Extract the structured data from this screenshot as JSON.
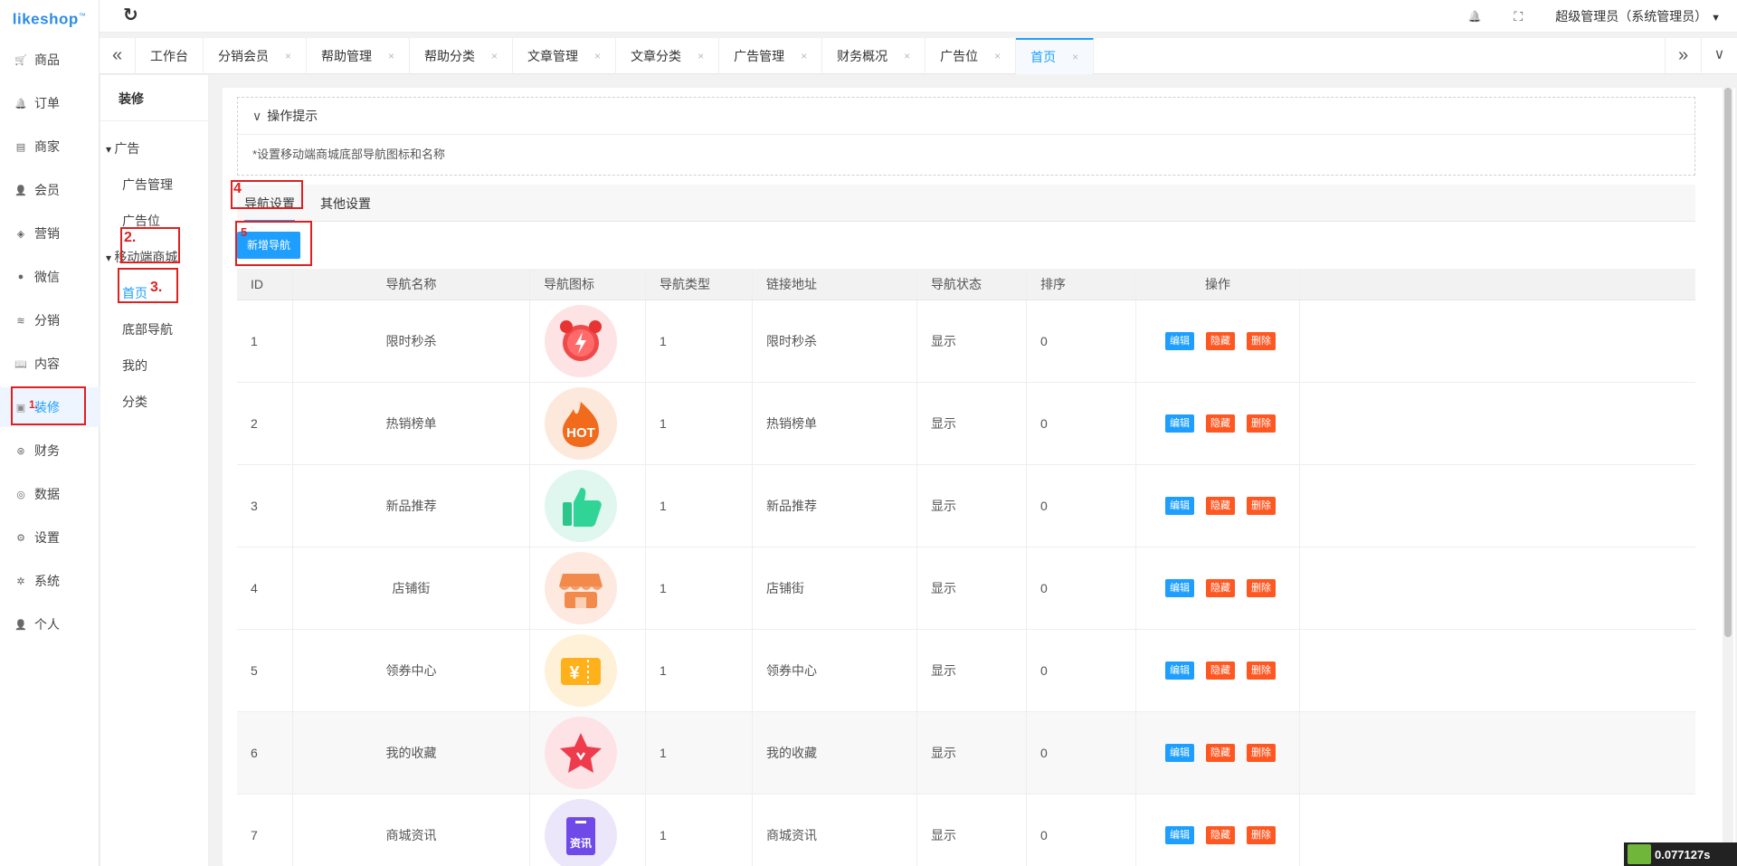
{
  "app": {
    "logo": "likeshop",
    "logo_tm": "™"
  },
  "sidebar": {
    "items": [
      {
        "label": "商品",
        "icon": "cart-icon",
        "glyph": "🛒"
      },
      {
        "label": "订单",
        "icon": "bell-icon",
        "glyph": "🔔"
      },
      {
        "label": "商家",
        "icon": "shop-icon",
        "glyph": "▤"
      },
      {
        "label": "会员",
        "icon": "user-icon",
        "glyph": "👤"
      },
      {
        "label": "营销",
        "icon": "gift-icon",
        "glyph": "◈"
      },
      {
        "label": "微信",
        "icon": "wechat-icon",
        "glyph": "●"
      },
      {
        "label": "分销",
        "icon": "layers-icon",
        "glyph": "≋"
      },
      {
        "label": "内容",
        "icon": "book-icon",
        "glyph": "📖"
      },
      {
        "label": "装修",
        "icon": "decorate-icon",
        "glyph": "▣"
      },
      {
        "label": "财务",
        "icon": "yen-icon",
        "glyph": "⊛"
      },
      {
        "label": "数据",
        "icon": "globe-icon",
        "glyph": "◎"
      },
      {
        "label": "设置",
        "icon": "settings-icon",
        "glyph": "⚙"
      },
      {
        "label": "系统",
        "icon": "system-icon",
        "glyph": "✲"
      },
      {
        "label": "个人",
        "icon": "person-icon",
        "glyph": "👤"
      }
    ]
  },
  "header": {
    "refresh": "↻",
    "bell": "🔔",
    "fullscreen": "⛶",
    "user": "超级管理员（系统管理员）",
    "caret": "▼"
  },
  "tabs": {
    "prev": "«",
    "next": "»",
    "menu": "∨",
    "close": "×",
    "items": [
      {
        "label": "工作台"
      },
      {
        "label": "分销会员"
      },
      {
        "label": "帮助管理"
      },
      {
        "label": "帮助分类"
      },
      {
        "label": "文章管理"
      },
      {
        "label": "文章分类"
      },
      {
        "label": "广告管理"
      },
      {
        "label": "财务概况"
      },
      {
        "label": "广告位"
      },
      {
        "label": "首页"
      }
    ]
  },
  "subside": {
    "title": "装修",
    "items": [
      {
        "label": "广告",
        "group": true
      },
      {
        "label": "广告管理"
      },
      {
        "label": "广告位"
      },
      {
        "label": "移动端商城",
        "group": true
      },
      {
        "label": "首页",
        "active": true
      },
      {
        "label": "底部导航"
      },
      {
        "label": "我的"
      },
      {
        "label": "分类"
      }
    ]
  },
  "tips": {
    "header": "操作提示",
    "text": "*设置移动端商城底部导航图标和名称"
  },
  "content_tabs": [
    "导航设置",
    "其他设置"
  ],
  "add_button": "新增导航",
  "table": {
    "headers": [
      "ID",
      "导航名称",
      "导航图标",
      "导航类型",
      "链接地址",
      "导航状态",
      "排序",
      "操作"
    ],
    "rows": [
      {
        "id": "1",
        "name": "限时秒杀",
        "icon": "alarm-clock-icon",
        "type": "1",
        "link": "限时秒杀",
        "state": "显示",
        "sort": "0"
      },
      {
        "id": "2",
        "name": "热销榜单",
        "icon": "hot-flame-icon",
        "type": "1",
        "link": "热销榜单",
        "state": "显示",
        "sort": "0"
      },
      {
        "id": "3",
        "name": "新品推荐",
        "icon": "thumbs-up-icon",
        "type": "1",
        "link": "新品推荐",
        "state": "显示",
        "sort": "0"
      },
      {
        "id": "4",
        "name": "店铺街",
        "icon": "store-icon",
        "type": "1",
        "link": "店铺街",
        "state": "显示",
        "sort": "0"
      },
      {
        "id": "5",
        "name": "领券中心",
        "icon": "coupon-icon",
        "type": "1",
        "link": "领券中心",
        "state": "显示",
        "sort": "0"
      },
      {
        "id": "6",
        "name": "我的收藏",
        "icon": "star-icon",
        "type": "1",
        "link": "我的收藏",
        "state": "显示",
        "sort": "0"
      },
      {
        "id": "7",
        "name": "商城资讯",
        "icon": "news-icon",
        "type": "1",
        "link": "商城资讯",
        "state": "显示",
        "sort": "0"
      }
    ],
    "actions": {
      "edit": "编辑",
      "hide": "隐藏",
      "delete": "删除"
    },
    "hot_text": "HOT",
    "yen": "¥",
    "news_text": "资讯"
  },
  "annotations": [
    "1.",
    "2.",
    "3.",
    "4",
    "5"
  ],
  "timer": "0.077127s",
  "colors": {
    "primary": "#1e9fff",
    "danger": "#ff5722",
    "annotation": "#e02020"
  }
}
